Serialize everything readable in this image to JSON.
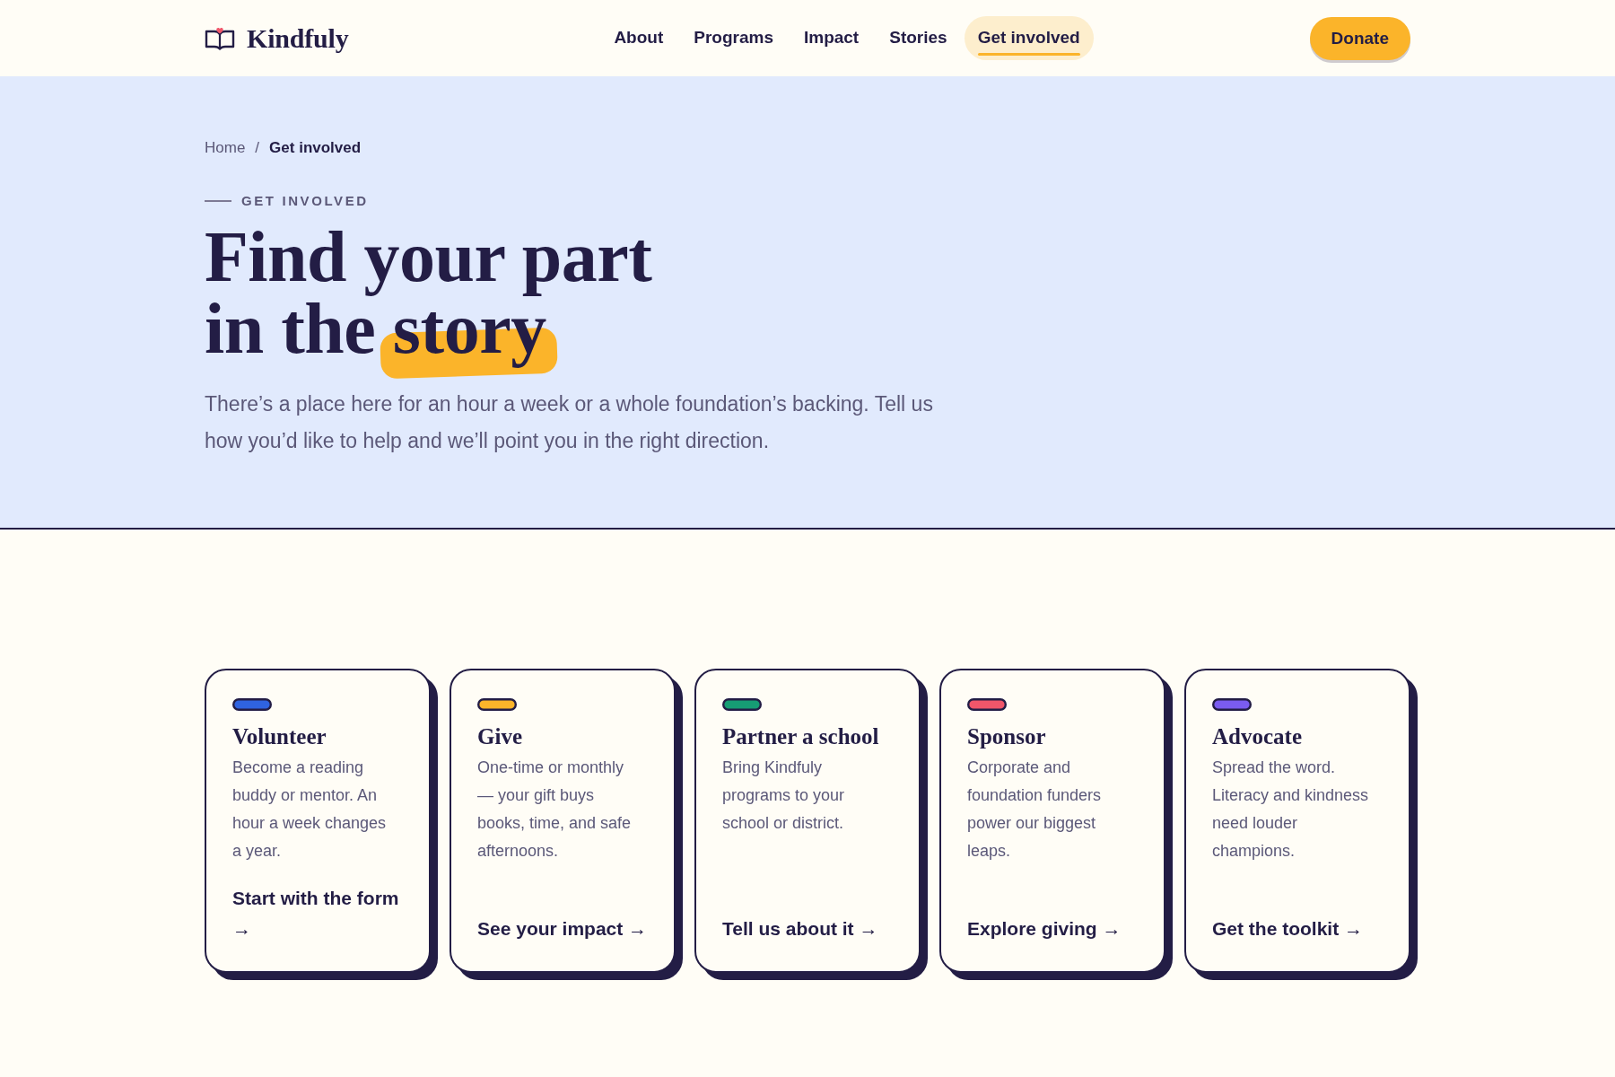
{
  "header": {
    "logo": "Kindfuly",
    "nav": [
      {
        "label": "About",
        "selected": false
      },
      {
        "label": "Programs",
        "selected": false
      },
      {
        "label": "Impact",
        "selected": false
      },
      {
        "label": "Stories",
        "selected": false
      },
      {
        "label": "Get involved",
        "selected": true
      }
    ],
    "donate_button": "Donate"
  },
  "hero": {
    "breadcrumb": {
      "items": [
        {
          "label": "Home",
          "current": false
        },
        {
          "label": "Get involved",
          "current": true
        }
      ],
      "separator": "/"
    },
    "eyebrow": "GET INVOLVED",
    "title_lines": [
      "Find your part",
      "in the"
    ],
    "title_highlight": "story",
    "intro": "There’s a place here for an hour a week or a whole foundation’s backing. Tell us how you’d like to help and we’ll point you in the right direction."
  },
  "cards": [
    {
      "title": "Volunteer",
      "color": "#2f63e0",
      "description": "Become a reading buddy or mentor. An hour a week changes a year.",
      "link": "Start with the form →"
    },
    {
      "title": "Give",
      "color": "#fbb42a",
      "description": "One-time or monthly — your gift buys books, time, and safe afternoons.",
      "link": "See your impact →"
    },
    {
      "title": "Partner a school",
      "color": "#169d74",
      "description": "Bring Kindfuly programs to your school or district.",
      "link": "Tell us about it →"
    },
    {
      "title": "Sponsor",
      "color": "#f0566a",
      "description": "Corporate and foundation funders power our biggest leaps.",
      "link": "Explore giving →"
    },
    {
      "title": "Advocate",
      "color": "#7a5cf0",
      "description": "Spread the word. Literacy and kindness need louder champions.",
      "link": "Get the toolkit →"
    }
  ]
}
